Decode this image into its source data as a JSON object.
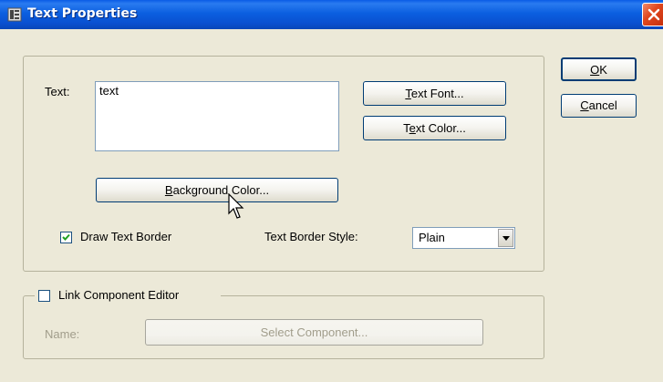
{
  "window": {
    "title": "Text Properties"
  },
  "text_group": {
    "text_label": "Text:",
    "text_value": "text",
    "text_font_button": {
      "mnemonic": "T",
      "rest": "ext Font..."
    },
    "text_color_button": {
      "pre": "T",
      "mnemonic": "e",
      "rest": "xt Color..."
    },
    "background_color_button": {
      "mnemonic": "B",
      "rest": "ackground Color..."
    },
    "draw_text_border": {
      "label": "Draw Text Border",
      "checked": true
    },
    "text_border_style_label": "Text Border Style:",
    "text_border_style_value": "Plain"
  },
  "link_group": {
    "checkbox_label": "Link Component Editor",
    "checked": false,
    "name_label": "Name:",
    "select_component_button": "Select Component..."
  },
  "dialog_buttons": {
    "ok": {
      "mnemonic": "O",
      "rest": "K"
    },
    "cancel": {
      "mnemonic": "C",
      "rest": "ancel"
    }
  },
  "icons": [
    "app-icon",
    "close-icon",
    "checkmark-icon",
    "dropdown-arrow-icon",
    "mouse-cursor-icon"
  ]
}
